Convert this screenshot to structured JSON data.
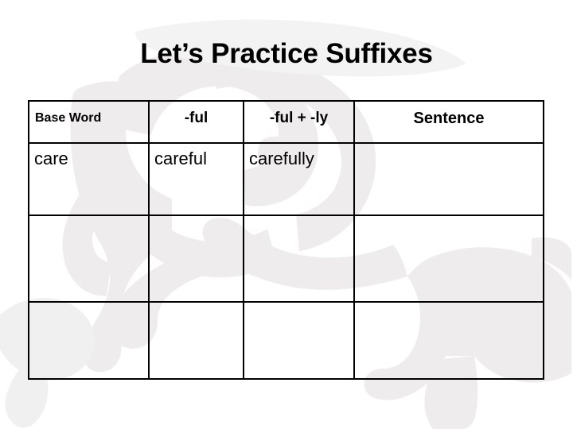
{
  "slide": {
    "title": "Let’s Practice Suffixes",
    "background_color": "#ffffff",
    "text_color": "#000000",
    "border_color": "#000000",
    "watermark_color": "#eeecec",
    "watermark_name": "elephant-silhouette"
  },
  "table": {
    "name": "suffix-practice-table",
    "columns": [
      {
        "key": "base_word",
        "label": "Base Word"
      },
      {
        "key": "ful",
        "label": "-ful"
      },
      {
        "key": "ful_ly",
        "label": "-ful + -ly"
      },
      {
        "key": "sentence",
        "label": "Sentence"
      }
    ],
    "rows": [
      {
        "base_word": "care",
        "ful": "careful",
        "ful_ly": "carefully",
        "sentence": ""
      },
      {
        "base_word": "",
        "ful": "",
        "ful_ly": "",
        "sentence": ""
      },
      {
        "base_word": "",
        "ful": "",
        "ful_ly": "",
        "sentence": ""
      }
    ]
  }
}
